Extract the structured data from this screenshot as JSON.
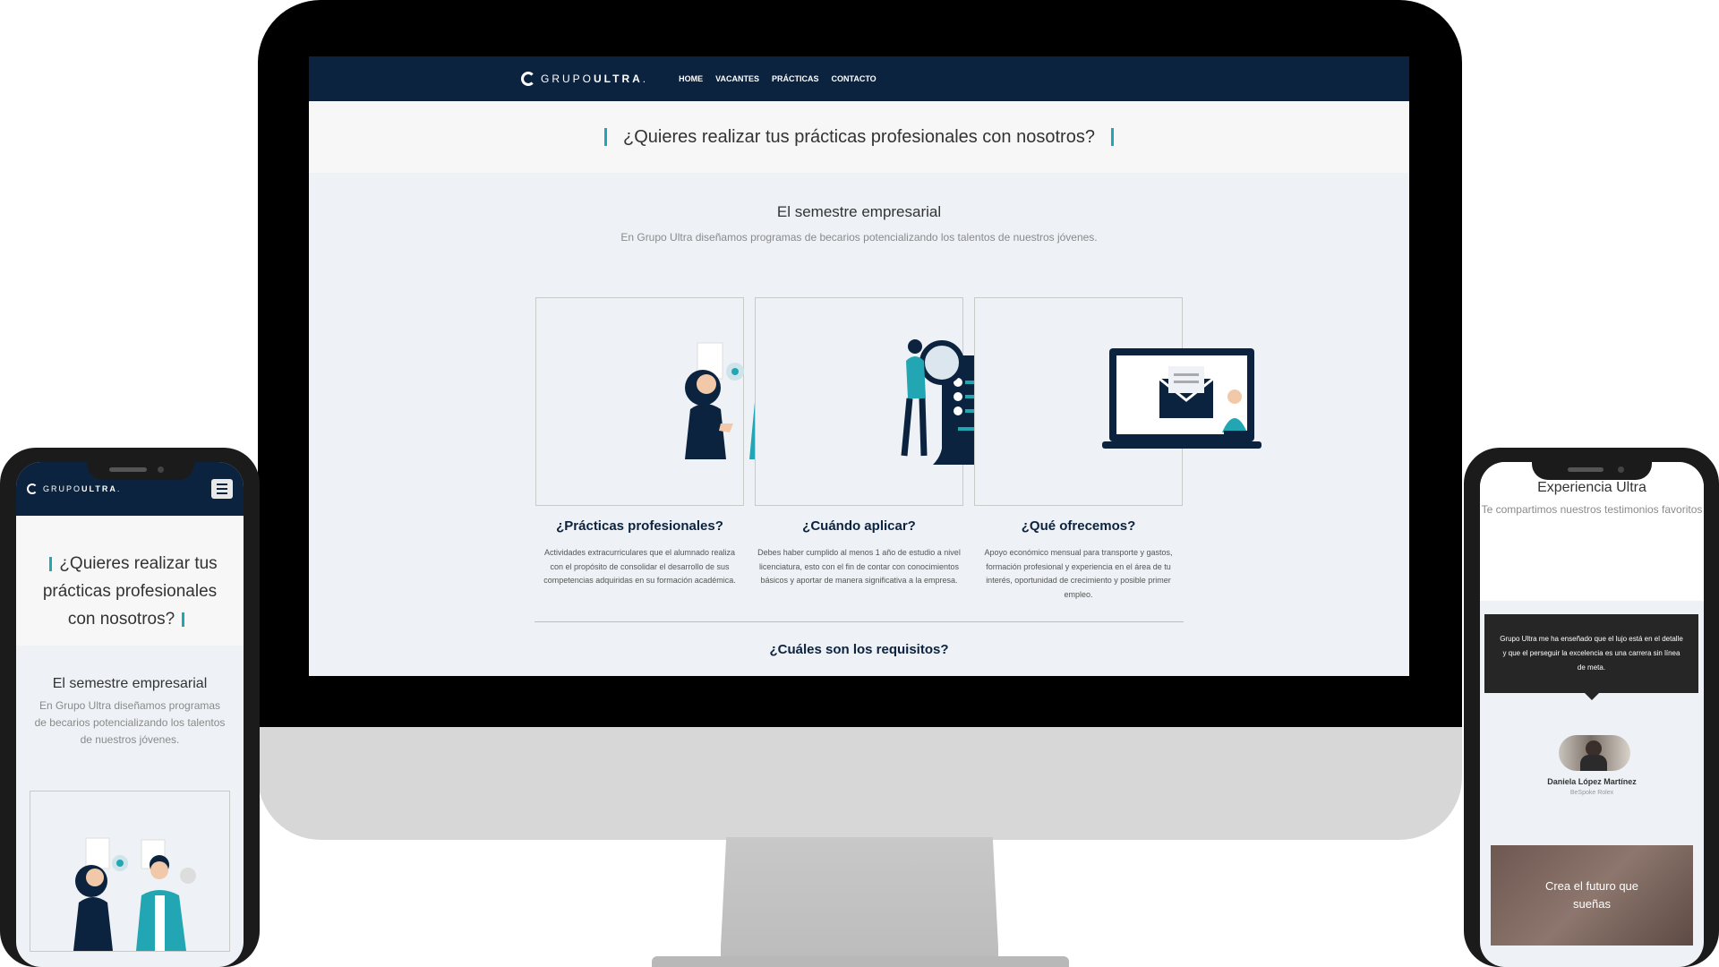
{
  "brand": {
    "name_light": "GRUPO",
    "name_bold": "ULTRA"
  },
  "desktop": {
    "nav": [
      "HOME",
      "VACANTES",
      "PRÁCTICAS",
      "CONTACTO"
    ],
    "hero_title": "¿Quieres realizar tus prácticas profesionales con nosotros?",
    "section_title": "El semestre empresarial",
    "section_text": "En Grupo Ultra diseñamos programas de becarios potencializando los talentos de nuestros jóvenes.",
    "cards": [
      {
        "title": "¿Prácticas profesionales?",
        "text": "Actividades extracurriculares que el alumnado realiza con el propósito de consolidar el desarrollo de sus competencias adquiridas en su formación académica."
      },
      {
        "title": "¿Cuándo aplicar?",
        "text": "Debes haber cumplido al menos 1 año de estudio a nivel licenciatura, esto con el fin de contar con conocimientos básicos y aportar de manera significativa a la empresa."
      },
      {
        "title": "¿Qué ofrecemos?",
        "text": "Apoyo económico mensual para transporte y gastos, formación profesional y experiencia en el área de tu interés, oportunidad de crecimiento y posible primer empleo."
      }
    ],
    "requirements_title": "¿Cuáles son los requisitos?"
  },
  "phone_left": {
    "hero_title": "¿Quieres realizar tus prácticas profesionales con nosotros?",
    "section_title": "El semestre empresarial",
    "section_text": "En Grupo Ultra diseñamos programas de becarios potencializando los talentos de nuestros jóvenes."
  },
  "phone_right": {
    "title": "Experiencia Ultra",
    "subtitle": "Te compartimos nuestros testimonios favoritos",
    "quote": "Grupo Ultra me ha enseñado que el lujo está en el detalle y que el perseguir la excelencia es una carrera sin línea de meta.",
    "author": "Daniela López Martínez",
    "role": "BeSpoke Rolex",
    "cta": "Crea el futuro que sueñas"
  },
  "colors": {
    "navy": "#0c2340",
    "teal": "#22a6b3"
  }
}
